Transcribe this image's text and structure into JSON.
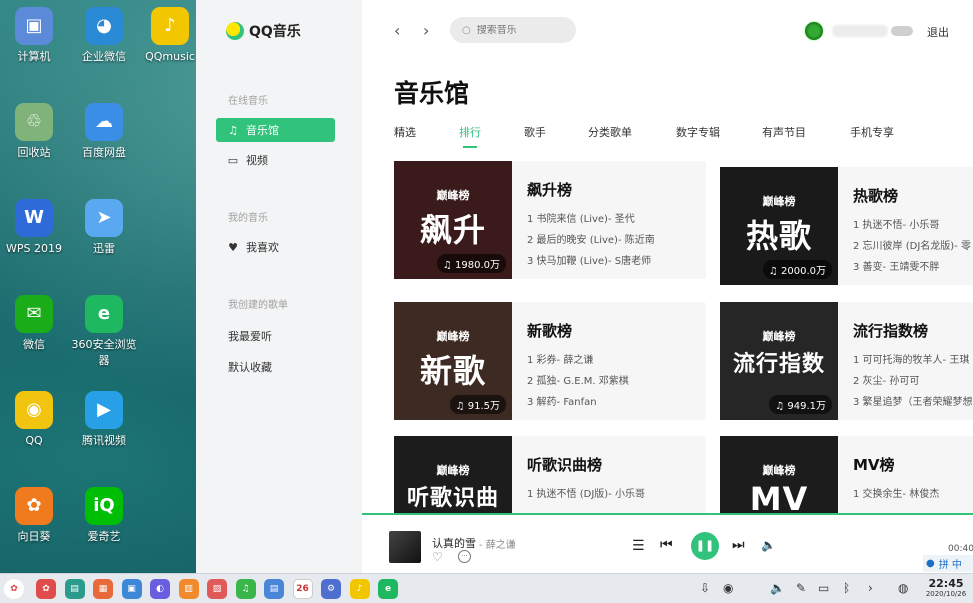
{
  "desktop": {
    "icons": [
      {
        "label": "计算机",
        "glyph": "▣",
        "color": "#5b8bd8"
      },
      {
        "label": "企业微信",
        "glyph": "◕",
        "color": "#2a8ad6"
      },
      {
        "label": "QQmusic",
        "glyph": "♪",
        "color": "#f2c600"
      },
      {
        "label": "回收站",
        "glyph": "♲",
        "color": "#7fb37a"
      },
      {
        "label": "百度网盘",
        "glyph": "☁",
        "color": "#3a8ee6"
      },
      {
        "label": "WPS 2019",
        "glyph": "W",
        "color": "#2f6bd8"
      },
      {
        "label": "迅雷",
        "glyph": "➤",
        "color": "#5aa8f0"
      },
      {
        "label": "微信",
        "glyph": "✉",
        "color": "#1aad19"
      },
      {
        "label": "360安全浏览器",
        "glyph": "e",
        "color": "#1db85f"
      },
      {
        "label": "QQ",
        "glyph": "◉",
        "color": "#f1c40f"
      },
      {
        "label": "腾讯视频",
        "glyph": "▶",
        "color": "#28a0e8"
      },
      {
        "label": "向日葵",
        "glyph": "✿",
        "color": "#f07a1e"
      },
      {
        "label": "爱奇艺",
        "glyph": "iQ",
        "color": "#00be06"
      }
    ]
  },
  "app": {
    "logo": "QQ音乐",
    "sidebar": {
      "online_title": "在线音乐",
      "items": [
        {
          "label": "音乐馆",
          "icon": "♫"
        },
        {
          "label": "视频",
          "icon": "▭"
        }
      ],
      "mine_title": "我的音乐",
      "favorite": {
        "label": "我喜欢",
        "icon": "♥"
      },
      "created_title": "我创建的歌单",
      "playlists": [
        "我最爱听",
        "默认收藏"
      ]
    },
    "header": {
      "back": "‹",
      "forward": "›",
      "search_placeholder": "搜索音乐",
      "logout": "退出"
    },
    "main": {
      "title": "音乐馆",
      "tabs": [
        "精选",
        "排行",
        "歌手",
        "分类歌单",
        "数字专辑",
        "有声节目",
        "手机专享"
      ],
      "active_tab": 1,
      "charts": [
        {
          "title": "飙升榜",
          "cover_big": "飙升",
          "cover_small": "巅峰榜",
          "count": "1980.0万",
          "cover_color": "#3a1a1a",
          "tracks": [
            "1  书院来信 (Live)- 圣代",
            "2  最后的晚安 (Live)- 陈近南",
            "3  快马加鞭 (Live)- S唐老师"
          ]
        },
        {
          "title": "热歌榜",
          "cover_big": "热歌",
          "cover_small": "巅峰榜",
          "count": "2000.0万",
          "cover_color": "#1a1a1a",
          "tracks": [
            "1  执迷不悟- 小乐哥",
            "2  忘川彼岸 (DJ名龙版)- 零",
            "3  善变- 王靖雯不胖"
          ]
        },
        {
          "title": "新歌榜",
          "cover_big": "新歌",
          "cover_small": "巅峰榜",
          "count": "91.5万",
          "cover_color": "#3d2a22",
          "tracks": [
            "1  彩券- 薛之谦",
            "2  孤独- G.E.M. 邓紫棋",
            "3  解药- Fanfan"
          ]
        },
        {
          "title": "流行指数榜",
          "cover_big": "流行指数",
          "cover_small": "巅峰榜",
          "count": "949.1万",
          "cover_color": "#262626",
          "tracks": [
            "1  可可托海的牧羊人- 王琪",
            "2  灰尘- 孙可可",
            "3  繁星追梦（王者荣耀梦想"
          ]
        },
        {
          "title": "听歌识曲榜",
          "cover_big": "听歌识曲",
          "cover_small": "巅峰榜",
          "count": "",
          "cover_color": "#1c1c1c",
          "tracks": [
            "1  执迷不悟 (DJ版)- 小乐哥"
          ]
        },
        {
          "title": "MV榜",
          "cover_big": "MV",
          "cover_small": "巅峰榜",
          "count": "",
          "cover_color": "#1c1c1c",
          "tracks": [
            "1  交换余生- 林俊杰"
          ]
        }
      ]
    },
    "player": {
      "song": "认真的雪",
      "artist": "- 薛之谦",
      "heart": "♡",
      "more": "···",
      "list_icon": "☰",
      "prev": "⏮",
      "play": "❚❚",
      "next": "⏭",
      "volume": "🔈",
      "time": "00:40",
      "ime": "拼 中"
    }
  },
  "taskbar": {
    "apps": [
      {
        "color": "#e04b4b",
        "glyph": "✿"
      },
      {
        "color": "#2b9c8c",
        "glyph": "▤"
      },
      {
        "color": "#e86a3a",
        "glyph": "▦"
      },
      {
        "color": "#3d88d8",
        "glyph": "▣"
      },
      {
        "color": "#6a5ee0",
        "glyph": "◐"
      },
      {
        "color": "#f08a2a",
        "glyph": "▥"
      },
      {
        "color": "#e05a5a",
        "glyph": "▨"
      },
      {
        "color": "#39b54a",
        "glyph": "♫"
      },
      {
        "color": "#4a86d8",
        "glyph": "▤"
      },
      {
        "color": "#ffffff",
        "glyph": "26"
      },
      {
        "color": "#4f6fd0",
        "glyph": "⚙"
      },
      {
        "color": "#f2c600",
        "glyph": "♪"
      },
      {
        "color": "#1db85f",
        "glyph": "e"
      }
    ],
    "time": "22:45",
    "date": "2020/10/26"
  }
}
